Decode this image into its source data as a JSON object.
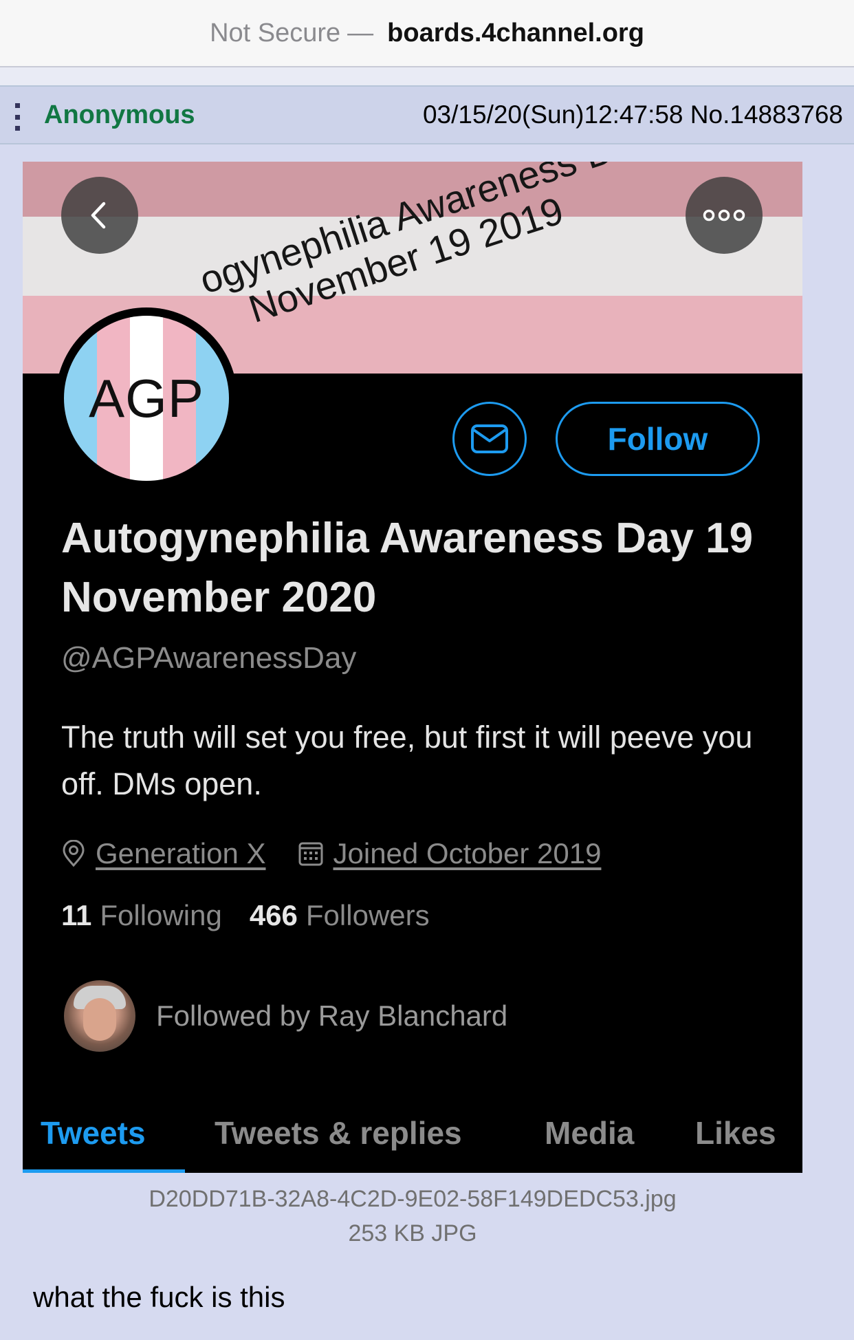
{
  "browser": {
    "security_label": "Not Secure",
    "separator": "—",
    "host": "boards.4channel.org"
  },
  "post": {
    "name": "Anonymous",
    "meta": "03/15/20(Sun)12:47:58 No.14883768",
    "file_name": "D20DD71B-32A8-4C2D-9E02-58F149DEDC53.jpg",
    "file_info": "253 KB JPG",
    "comment": "what the fuck is this"
  },
  "twitter": {
    "banner_line1": "ogynephilia Awareness D",
    "banner_line2": "November 19 2019",
    "avatar_text": "AGP",
    "follow_label": "Follow",
    "display_name": "Autogynephilia Awareness Day 19 November 2020",
    "handle": "@AGPAwarenessDay",
    "bio": "The truth will set you free, but first it will peeve you off. DMs open.",
    "location": "Generation X",
    "joined": "Joined October 2019",
    "following_count": "11",
    "following_label": "Following",
    "followers_count": "466",
    "followers_label": "Followers",
    "followed_by": "Followed by Ray Blanchard",
    "tabs": [
      "Tweets",
      "Tweets & replies",
      "Media",
      "Likes"
    ],
    "active_tab": "Tweets",
    "accent_color": "#1d9bf0"
  },
  "colors": {
    "board_bg": "#d6daf0",
    "post_header_bg": "#cdd3ea",
    "name_green": "#117743"
  },
  "icons": [
    "menu-dots-icon",
    "back-arrow-icon",
    "more-options-icon",
    "mail-icon",
    "location-pin-icon",
    "calendar-icon"
  ]
}
